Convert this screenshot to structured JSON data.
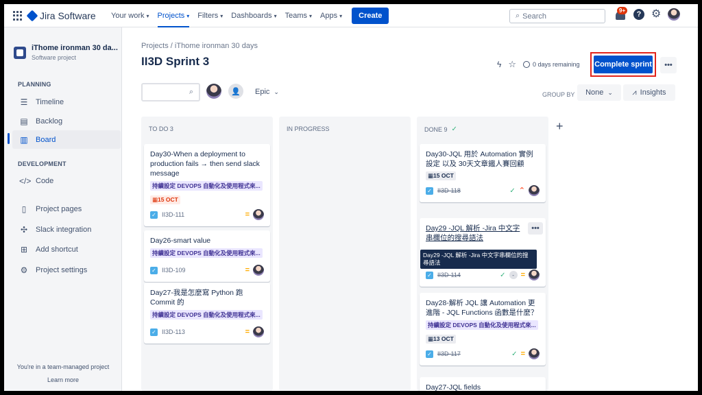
{
  "topnav": {
    "product": "Jira Software",
    "items": [
      {
        "label": "Your work",
        "active": false,
        "caret": true
      },
      {
        "label": "Projects",
        "active": true,
        "caret": true
      },
      {
        "label": "Filters",
        "active": false,
        "caret": true
      },
      {
        "label": "Dashboards",
        "active": false,
        "caret": true
      },
      {
        "label": "Teams",
        "active": false,
        "caret": true
      },
      {
        "label": "Apps",
        "active": false,
        "caret": true
      }
    ],
    "create_label": "Create",
    "search_placeholder": "Search",
    "notification_badge": "9+",
    "help_glyph": "?"
  },
  "sidebar": {
    "project_name": "iThome ironman 30 da...",
    "project_type": "Software project",
    "planning_label": "PLANNING",
    "development_label": "DEVELOPMENT",
    "items": {
      "timeline": "Timeline",
      "backlog": "Backlog",
      "board": "Board",
      "code": "Code",
      "project_pages": "Project pages",
      "slack": "Slack integration",
      "shortcut": "Add shortcut",
      "settings": "Project settings"
    },
    "team_note": "You're in a team-managed project",
    "learn_more": "Learn more"
  },
  "header": {
    "breadcrumb": "Projects  /  iThome ironman 30 days",
    "title": "II3D Sprint 3",
    "remaining": "0 days remaining",
    "complete_label": "Complete sprint",
    "more": "•••"
  },
  "toolbar": {
    "epic_label": "Epic",
    "group_by_label": "GROUP BY",
    "group_by_value": "None",
    "insights_label": "Insights"
  },
  "columns": {
    "todo": {
      "title": "TO DO 3"
    },
    "inprogress": {
      "title": "IN PROGRESS"
    },
    "done": {
      "title": "DONE 9"
    }
  },
  "cards": {
    "todo": [
      {
        "title": "Day30-When a deployment to production fails → then send slack message",
        "epic": "持續設定 DEVOPS 自動化及使用程式來...",
        "date": "15 OCT",
        "key": "II3D-111"
      },
      {
        "title": "Day26-smart value",
        "epic": "持續設定 DEVOPS 自動化及使用程式來...",
        "key": "II3D-109"
      },
      {
        "title": "Day27-我是怎麼寫 Python 跑 Commit 的",
        "epic": "持續設定 DEVOPS 自動化及使用程式來...",
        "key": "II3D-113"
      }
    ],
    "done": [
      {
        "title": "Day30-JQL 用於 Automation 實例設定 以及 30天文章鐵人賽回顧",
        "date": "15 OCT",
        "key": "II3D-118"
      },
      {
        "title": "Day29 -JQL 解析 -Jira 中文字串欄位的搜尋語法",
        "key": "II3D-114",
        "estimate": "-"
      },
      {
        "title": "Day28-解析 JQL 讓 Automation 更進階 - JQL Functions 函數是什麼？",
        "epic": "持續設定 DEVOPS 自動化及使用程式來...",
        "date": "13 OCT",
        "key": "II3D-117"
      },
      {
        "title": "Day27-JQL fields"
      }
    ]
  },
  "tooltip": "Day29 -JQL 解析 -Jira 中文字串欄位的搜尋語法",
  "colors": {
    "accent": "#0052CC",
    "highlight": "#E2231A",
    "epic": "#EAE6FF",
    "overdue": "#DE350B",
    "done": "#36B37E"
  }
}
